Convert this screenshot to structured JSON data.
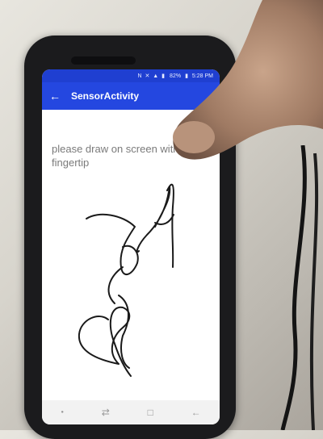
{
  "status_bar": {
    "battery": "82%",
    "time": "5:28 PM",
    "icons": [
      "nfc-icon",
      "mute-icon",
      "wifi-icon",
      "signal-icon",
      "battery-icon"
    ]
  },
  "app_bar": {
    "title": "SensorActivity",
    "back_icon": "back-arrow-icon"
  },
  "content": {
    "instruction": "please draw on screen with your fingertip",
    "drawing": "handwritten-signature"
  },
  "nav_bar": {
    "icons": [
      "nav-dot-icon",
      "recent-apps-icon",
      "home-icon",
      "back-icon"
    ]
  },
  "colors": {
    "app_bar": "#2447e0",
    "status_bar": "#1f3fd1",
    "ink": "#1a1a1a"
  }
}
